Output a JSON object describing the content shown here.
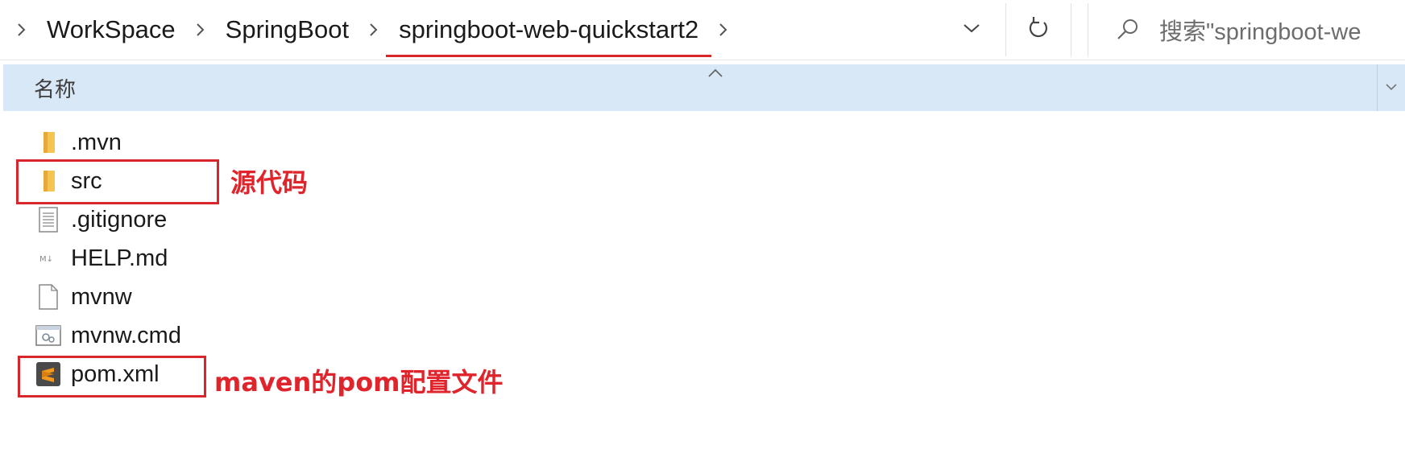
{
  "address_bar": {
    "breadcrumbs": [
      "WorkSpace",
      "SpringBoot",
      "springboot-web-quickstart2"
    ],
    "search_placeholder": "搜索\"springboot-we"
  },
  "header": {
    "name_column": "名称"
  },
  "files": [
    {
      "name": ".mvn",
      "icon": "folder-icon"
    },
    {
      "name": "src",
      "icon": "folder-icon"
    },
    {
      "name": ".gitignore",
      "icon": "text-file-icon"
    },
    {
      "name": "HELP.md",
      "icon": "markdown-file-icon"
    },
    {
      "name": "mvnw",
      "icon": "blank-file-icon"
    },
    {
      "name": "mvnw.cmd",
      "icon": "cmd-file-icon"
    },
    {
      "name": "pom.xml",
      "icon": "sublime-file-icon"
    }
  ],
  "annotations": {
    "src_note": "源代码",
    "pom_note": "maven的pom配置文件"
  },
  "colors": {
    "highlight": "#d9262c",
    "header_bg": "#d9e8f6",
    "folder": "#f4c553"
  }
}
